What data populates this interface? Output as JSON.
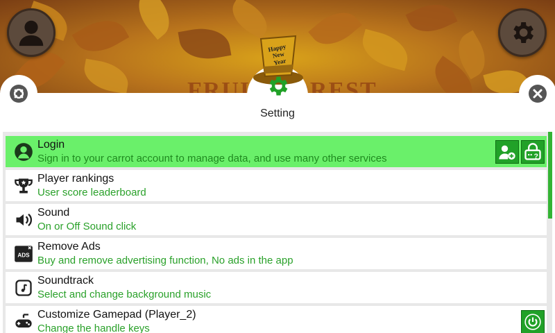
{
  "header": {
    "background_title": "FRUIT FOREST",
    "hat_text": "Happy New Year",
    "profile_icon": "user-icon",
    "settings_icon": "gear-icon"
  },
  "panel": {
    "title": "Setting",
    "left_icon": "reset-icon",
    "right_icon": "close-icon",
    "center_icon": "gear-icon"
  },
  "items": [
    {
      "title": "Login",
      "subtitle": "Sign in to your carrot account to manage data, and use many other services",
      "icon": "user-icon",
      "active": true
    },
    {
      "title": "Player rankings",
      "subtitle": "User score leaderboard",
      "icon": "trophy-icon"
    },
    {
      "title": "Sound",
      "subtitle": "On or Off Sound click",
      "icon": "speaker-icon"
    },
    {
      "title": "Remove Ads",
      "subtitle": "Buy and remove advertising function, No ads in the app",
      "icon": "ads-icon"
    },
    {
      "title": "Soundtrack",
      "subtitle": "Select and change background music",
      "icon": "music-file-icon"
    },
    {
      "title": "Customize Gamepad (Player_2)",
      "subtitle": "Change the handle keys",
      "icon": "gamepad-icon"
    }
  ],
  "colors": {
    "accent": "#21a128",
    "active_row": "#6af06a",
    "subtitle": "#2aa12a"
  }
}
